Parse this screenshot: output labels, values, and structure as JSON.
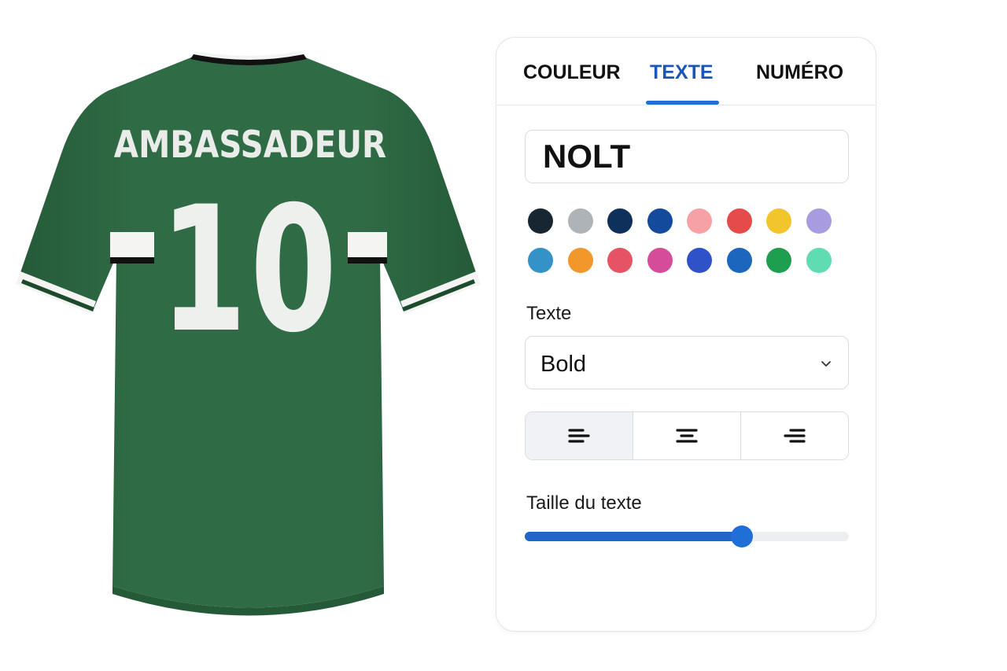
{
  "jersey": {
    "name": "AMBASSADEUR",
    "number": "10",
    "body_color": "#2f6b45",
    "trim_color": "#f4f4f2",
    "collar_color": "#111111"
  },
  "tabs": [
    {
      "label": "COULEUR",
      "active": false
    },
    {
      "label": "TEXTE",
      "active": true
    },
    {
      "label": "NUMÉRO",
      "active": false
    }
  ],
  "text_input": {
    "value": "NOLT"
  },
  "swatches": [
    [
      "#172630",
      "#aeb3b7",
      "#10305c",
      "#134a9c",
      "#f5a1a6",
      "#e54b4b",
      "#f2c52d",
      "#a99be0"
    ],
    [
      "#3592c8",
      "#f1972c",
      "#e55364",
      "#d44c9a",
      "#2f52c8",
      "#1c67bd",
      "#1e9e4f",
      "#5fdcb2"
    ]
  ],
  "font_label": "Texte",
  "font_select": {
    "value": "Bold",
    "icon": "chevron-down-icon"
  },
  "alignment": {
    "options": [
      "align-left-icon",
      "align-center-icon",
      "align-right-icon"
    ],
    "selected": "left"
  },
  "size_label": "Taille du texte",
  "size_slider": {
    "value": 0.67,
    "accent": "#1f66c8"
  }
}
